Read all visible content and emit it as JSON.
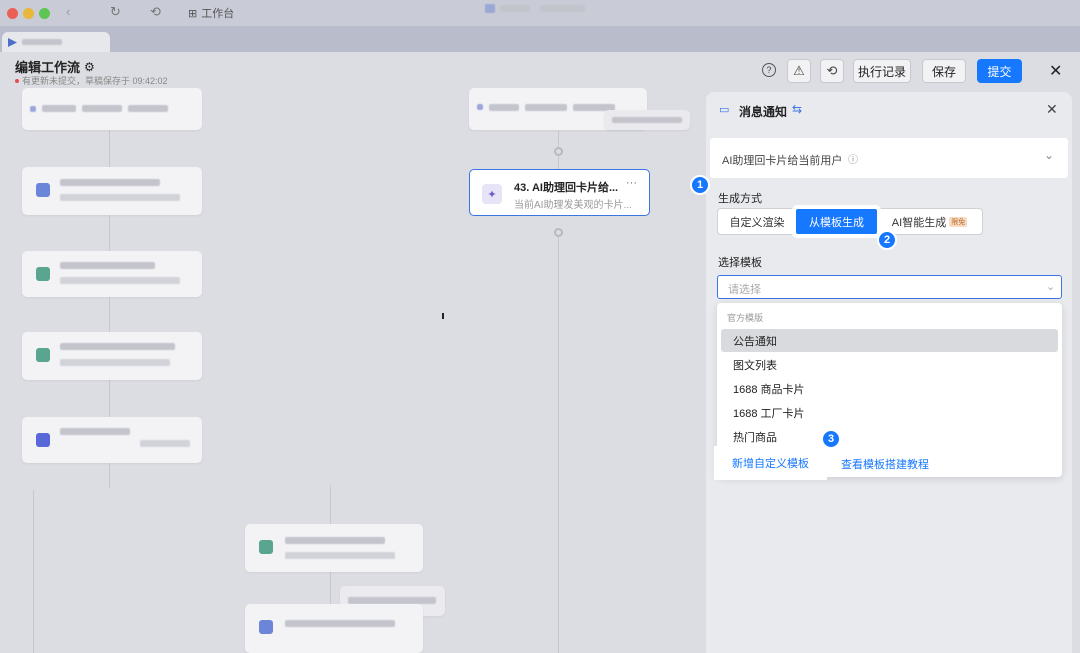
{
  "titlebar": {
    "workbench_label": "工作台",
    "icons": [
      "history-icon",
      "refresh-icon",
      "grid-icon"
    ]
  },
  "header": {
    "title": "编辑工作流",
    "status": "有更新未提交，草稿保存于 09:42:02",
    "buttons": {
      "run_log": "执行记录",
      "save": "保存",
      "submit": "提交"
    },
    "icons": [
      "help-icon",
      "warning-icon",
      "history-icon",
      "close-icon"
    ]
  },
  "canvas": {
    "active_node": {
      "title": "43. AI助理回卡片给...",
      "subtitle": "当前AI助理发美观的卡片...",
      "more": "···"
    }
  },
  "panel": {
    "title": "消息通知",
    "target": {
      "label": "AI助理回卡片给当前用户"
    },
    "mode_label": "生成方式",
    "modes": [
      {
        "label": "自定义渲染",
        "active": false
      },
      {
        "label": "从模板生成",
        "active": true
      },
      {
        "label": "AI智能生成",
        "active": false,
        "tag": "限免"
      }
    ],
    "template_label": "选择模板",
    "template_placeholder": "请选择",
    "dropdown": {
      "group_label": "官方模版",
      "items": [
        "公告通知",
        "图文列表",
        "1688 商品卡片",
        "1688 工厂卡片",
        "热门商品"
      ],
      "selected_index": 0,
      "add_custom": "新增自定义模板",
      "tutorial": "查看模板搭建教程"
    }
  },
  "steps": [
    "1",
    "2",
    "3"
  ],
  "colors": {
    "accent": "#1677ff",
    "active_node_border": "#3b74e6",
    "status_dot": "#e34d4d"
  }
}
